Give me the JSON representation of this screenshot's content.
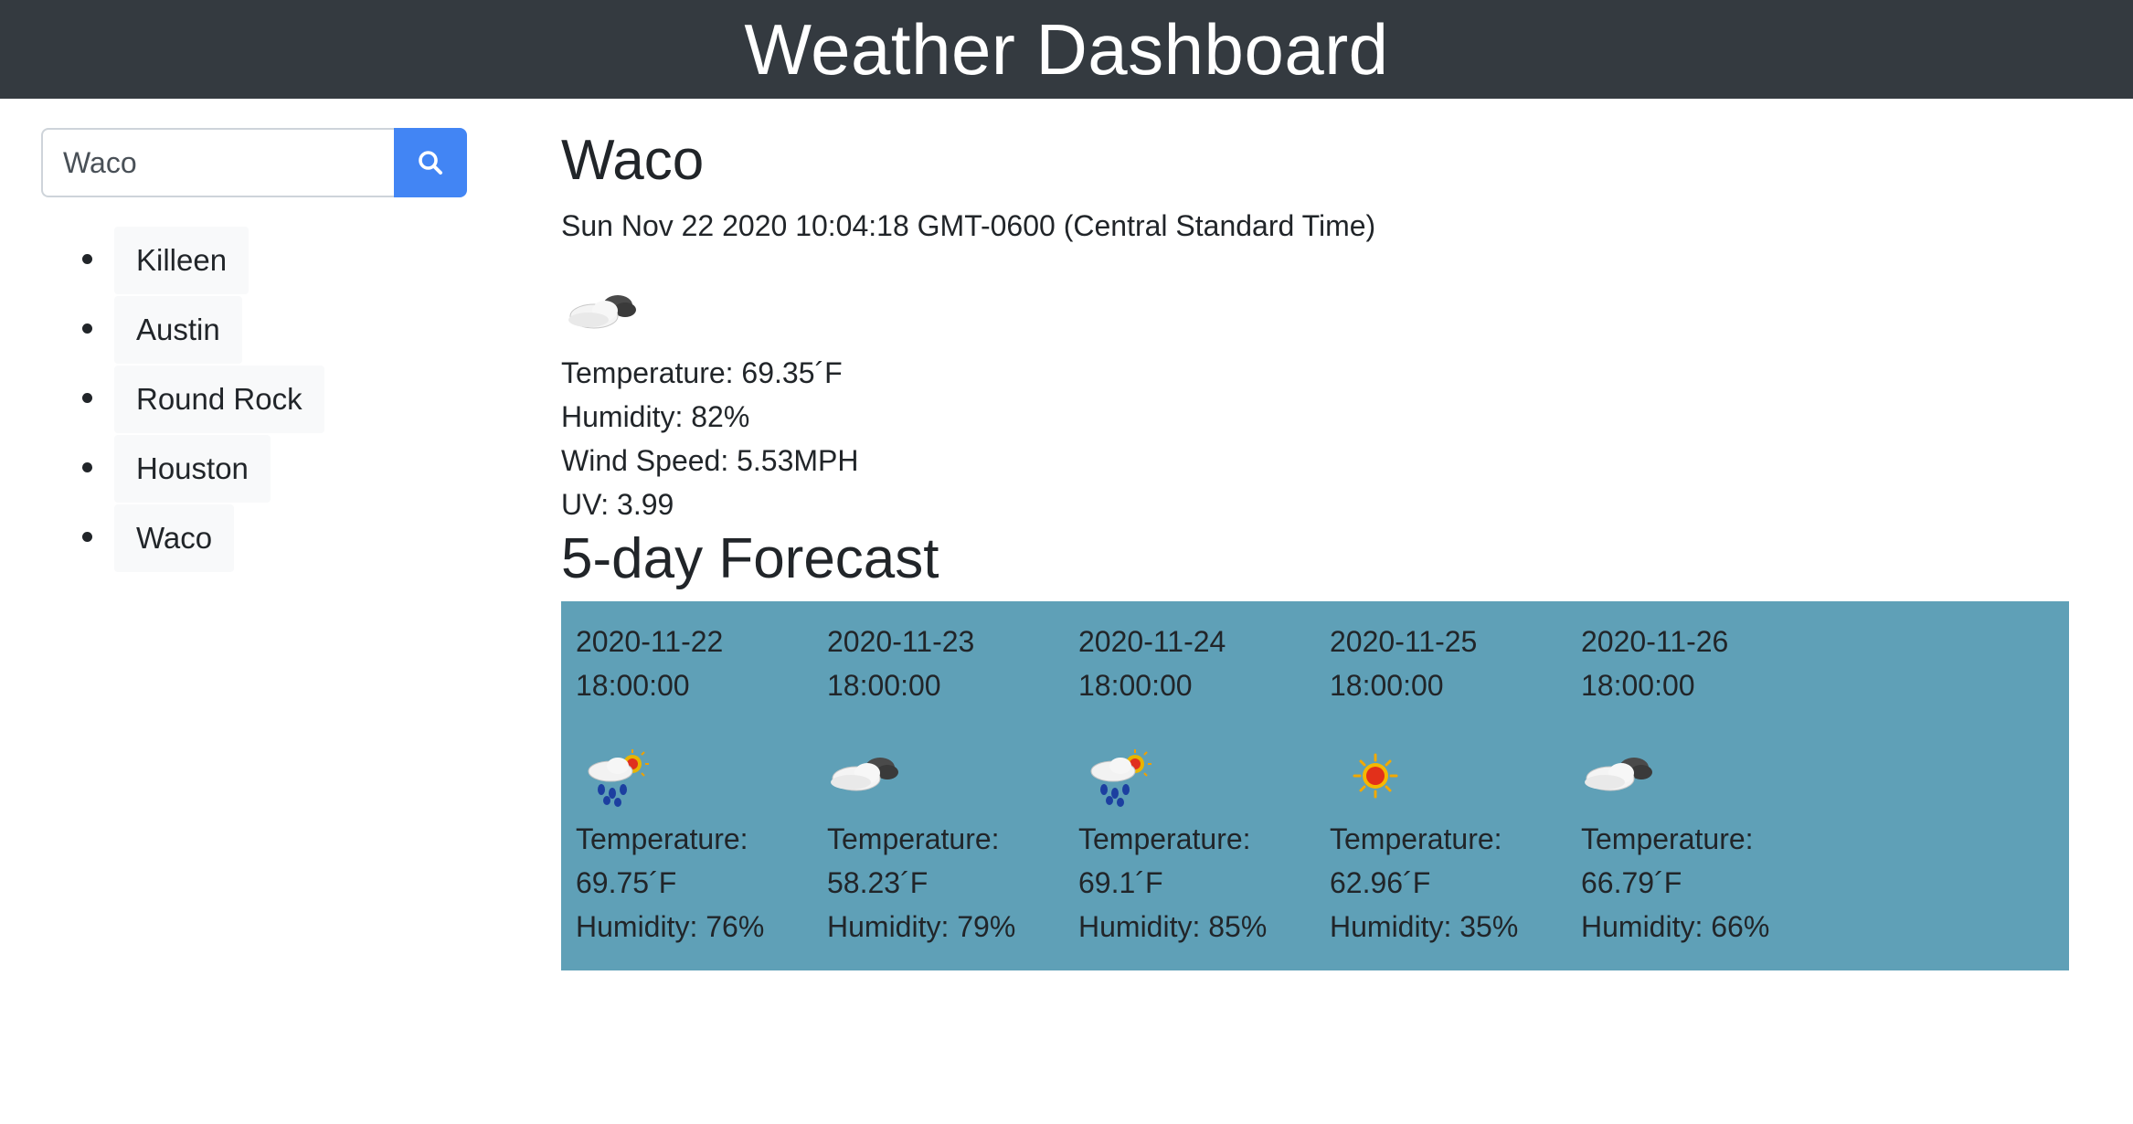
{
  "header": {
    "title": "Weather Dashboard"
  },
  "search": {
    "value": "Waco",
    "placeholder": ""
  },
  "history": [
    "Killeen",
    "Austin",
    "Round Rock",
    "Houston",
    "Waco"
  ],
  "current": {
    "city": "Waco",
    "date": "Sun Nov 22 2020 10:04:18 GMT-0600 (Central Standard Time)",
    "icon": "partly-cloudy-icon",
    "temperature": "Temperature: 69.35´F",
    "humidity": "Humidity: 82%",
    "wind": "Wind Speed: 5.53MPH",
    "uv": "UV: 3.99"
  },
  "forecast": {
    "title": "5-day Forecast",
    "panel_color": "#5fa0b7",
    "days": [
      {
        "date": "2020-11-22",
        "time": "18:00:00",
        "icon": "rain-sun-icon",
        "temp_label": "Temperature:",
        "temp": "69.75´F",
        "humidity": "Humidity: 76%"
      },
      {
        "date": "2020-11-23",
        "time": "18:00:00",
        "icon": "partly-cloudy-icon",
        "temp_label": "Temperature:",
        "temp": "58.23´F",
        "humidity": "Humidity: 79%"
      },
      {
        "date": "2020-11-24",
        "time": "18:00:00",
        "icon": "rain-sun-icon",
        "temp_label": "Temperature:",
        "temp": "69.1´F",
        "humidity": "Humidity: 85%"
      },
      {
        "date": "2020-11-25",
        "time": "18:00:00",
        "icon": "sun-icon",
        "temp_label": "Temperature:",
        "temp": "62.96´F",
        "humidity": "Humidity: 35%"
      },
      {
        "date": "2020-11-26",
        "time": "18:00:00",
        "icon": "partly-cloudy-icon",
        "temp_label": "Temperature:",
        "temp": "66.79´F",
        "humidity": "Humidity: 66%"
      }
    ]
  },
  "colors": {
    "navbar": "#343a40",
    "search_button": "#4285f4",
    "forecast_panel": "#5fa0b7"
  }
}
